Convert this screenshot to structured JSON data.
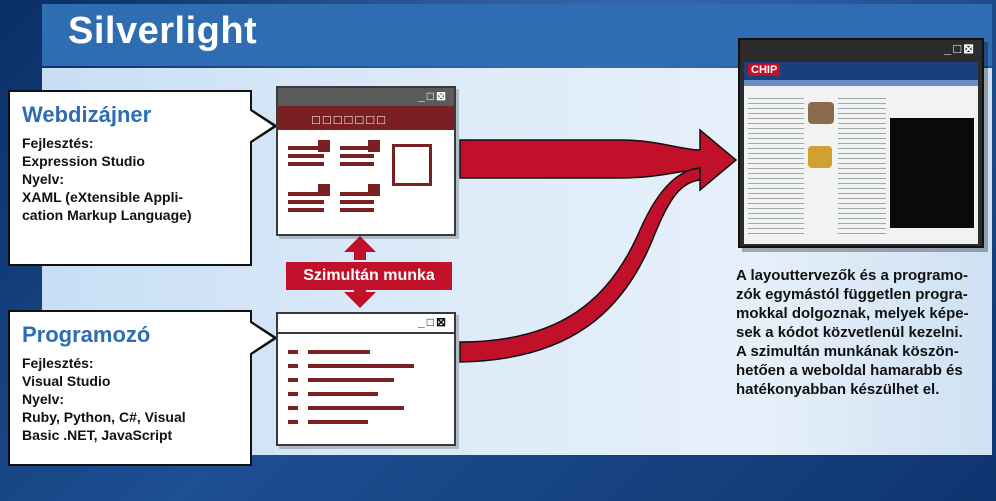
{
  "title": "Silverlight",
  "webdesigner": {
    "heading": "Webdizájner",
    "line1": "Fejlesztés:",
    "line2": "Expression Studio",
    "line3": "Nyelv:",
    "line4": "XAML (eXtensible Appli-",
    "line5": "cation Markup Language)"
  },
  "programmer": {
    "heading": "Programozó",
    "line1": "Fejlesztés:",
    "line2": "Visual Studio",
    "line3": "Nyelv:",
    "line4": "Ruby, Python, C#, Visual",
    "line5": "Basic .NET, JavaScript"
  },
  "badge": "Szimultán munka",
  "window_controls": "_□⊠",
  "caption_lines": [
    "A layouttervezők és a programo-",
    "zók egymástól független progra-",
    "mokkal dolgoznak, melyek képe-",
    "sek a kódot közvetlenül kezelni.",
    "A szimultán munkának köszön-",
    "hetően a weboldal hamarabb és",
    "hatékonyabban készülhet el."
  ],
  "screenshot_logo": "CHIP",
  "colors": {
    "accent": "#2f6db3",
    "maroon": "#7a1f22",
    "red": "#c0102a"
  }
}
